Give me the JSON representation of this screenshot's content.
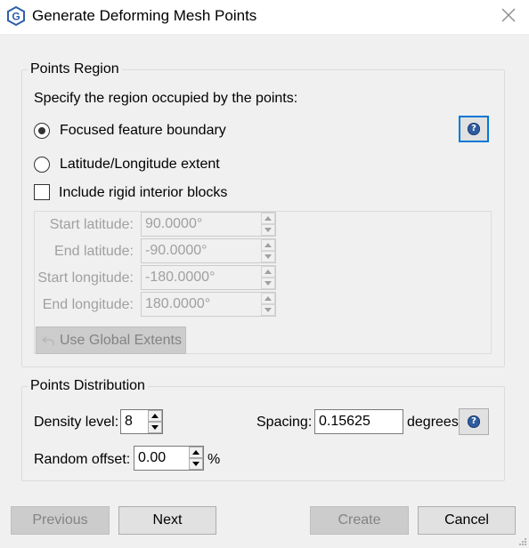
{
  "window": {
    "title": "Generate Deforming Mesh Points",
    "app_icon_letter": "G"
  },
  "points_region": {
    "title": "Points Region",
    "instruction": "Specify the region occupied by the points:",
    "options": [
      {
        "label": "Focused feature boundary",
        "selected": true
      },
      {
        "label": "Latitude/Longitude extent",
        "selected": false
      }
    ],
    "include_rigid_label": "Include rigid interior blocks",
    "include_rigid_checked": false,
    "help_icon": "help-icon",
    "extents": {
      "enabled": false,
      "start_latitude": {
        "label": "Start latitude:",
        "value": "90.0000°"
      },
      "end_latitude": {
        "label": "End latitude:",
        "value": "-90.0000°"
      },
      "start_longitude": {
        "label": "Start longitude:",
        "value": "-180.0000°"
      },
      "end_longitude": {
        "label": "End longitude:",
        "value": "180.0000°"
      },
      "use_global_label": "Use Global Extents"
    }
  },
  "points_distribution": {
    "title": "Points Distribution",
    "density_label": "Density level:",
    "density_value": "8",
    "spacing_label": "Spacing:",
    "spacing_value": "0.15625",
    "spacing_unit": "degrees",
    "random_offset_label": "Random offset:",
    "random_offset_value": "0.00",
    "random_offset_unit": "%"
  },
  "footer": {
    "previous_label": "Previous",
    "next_label": "Next",
    "create_label": "Create",
    "cancel_label": "Cancel"
  },
  "colors": {
    "focus_border": "#0078d7",
    "help_icon": "#2f5c9e",
    "disabled_text": "#a0a0a0"
  }
}
